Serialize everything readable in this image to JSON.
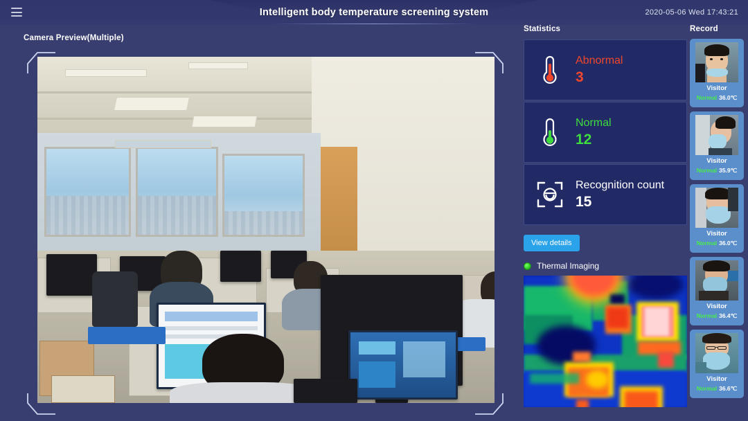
{
  "header": {
    "menu_icon": "hamburger-menu-icon",
    "title": "Intelligent body temperature screening system",
    "datetime": "2020-05-06  Wed  17:43:21"
  },
  "camera": {
    "label": "Camera Preview(Multiple)"
  },
  "statistics": {
    "title": "Statistics",
    "cards": [
      {
        "icon": "thermometer-red-icon",
        "label": "Abnormal",
        "value": "3",
        "color": "#f0462c"
      },
      {
        "icon": "thermometer-green-icon",
        "label": "Normal",
        "value": "12",
        "color": "#3fdc3f"
      },
      {
        "icon": "face-recognition-icon",
        "label": "Recognition count",
        "value": "15",
        "color": "#ffffff"
      }
    ],
    "view_details_label": "View details",
    "thermal": {
      "status_icon": "status-dot-green-icon",
      "label": "Thermal Imaging"
    }
  },
  "record": {
    "title": "Record",
    "items": [
      {
        "name": "Visitor",
        "status": "Normal",
        "temperature": "36.0℃"
      },
      {
        "name": "Visitor",
        "status": "Normal",
        "temperature": "35.9℃"
      },
      {
        "name": "Visitor",
        "status": "Normal",
        "temperature": "36.0℃"
      },
      {
        "name": "Visitor",
        "status": "Normal",
        "temperature": "36.4℃"
      },
      {
        "name": "Visitor",
        "status": "Normal",
        "temperature": "36.6℃"
      }
    ]
  },
  "colors": {
    "background": "#393e71",
    "header": "#2f3569",
    "card": "#222a66",
    "card_border": "#3e4a86",
    "accent_button": "#2ba3ea",
    "record_card": "#5b8fcc",
    "abnormal": "#f0462c",
    "normal": "#3fdc3f"
  }
}
